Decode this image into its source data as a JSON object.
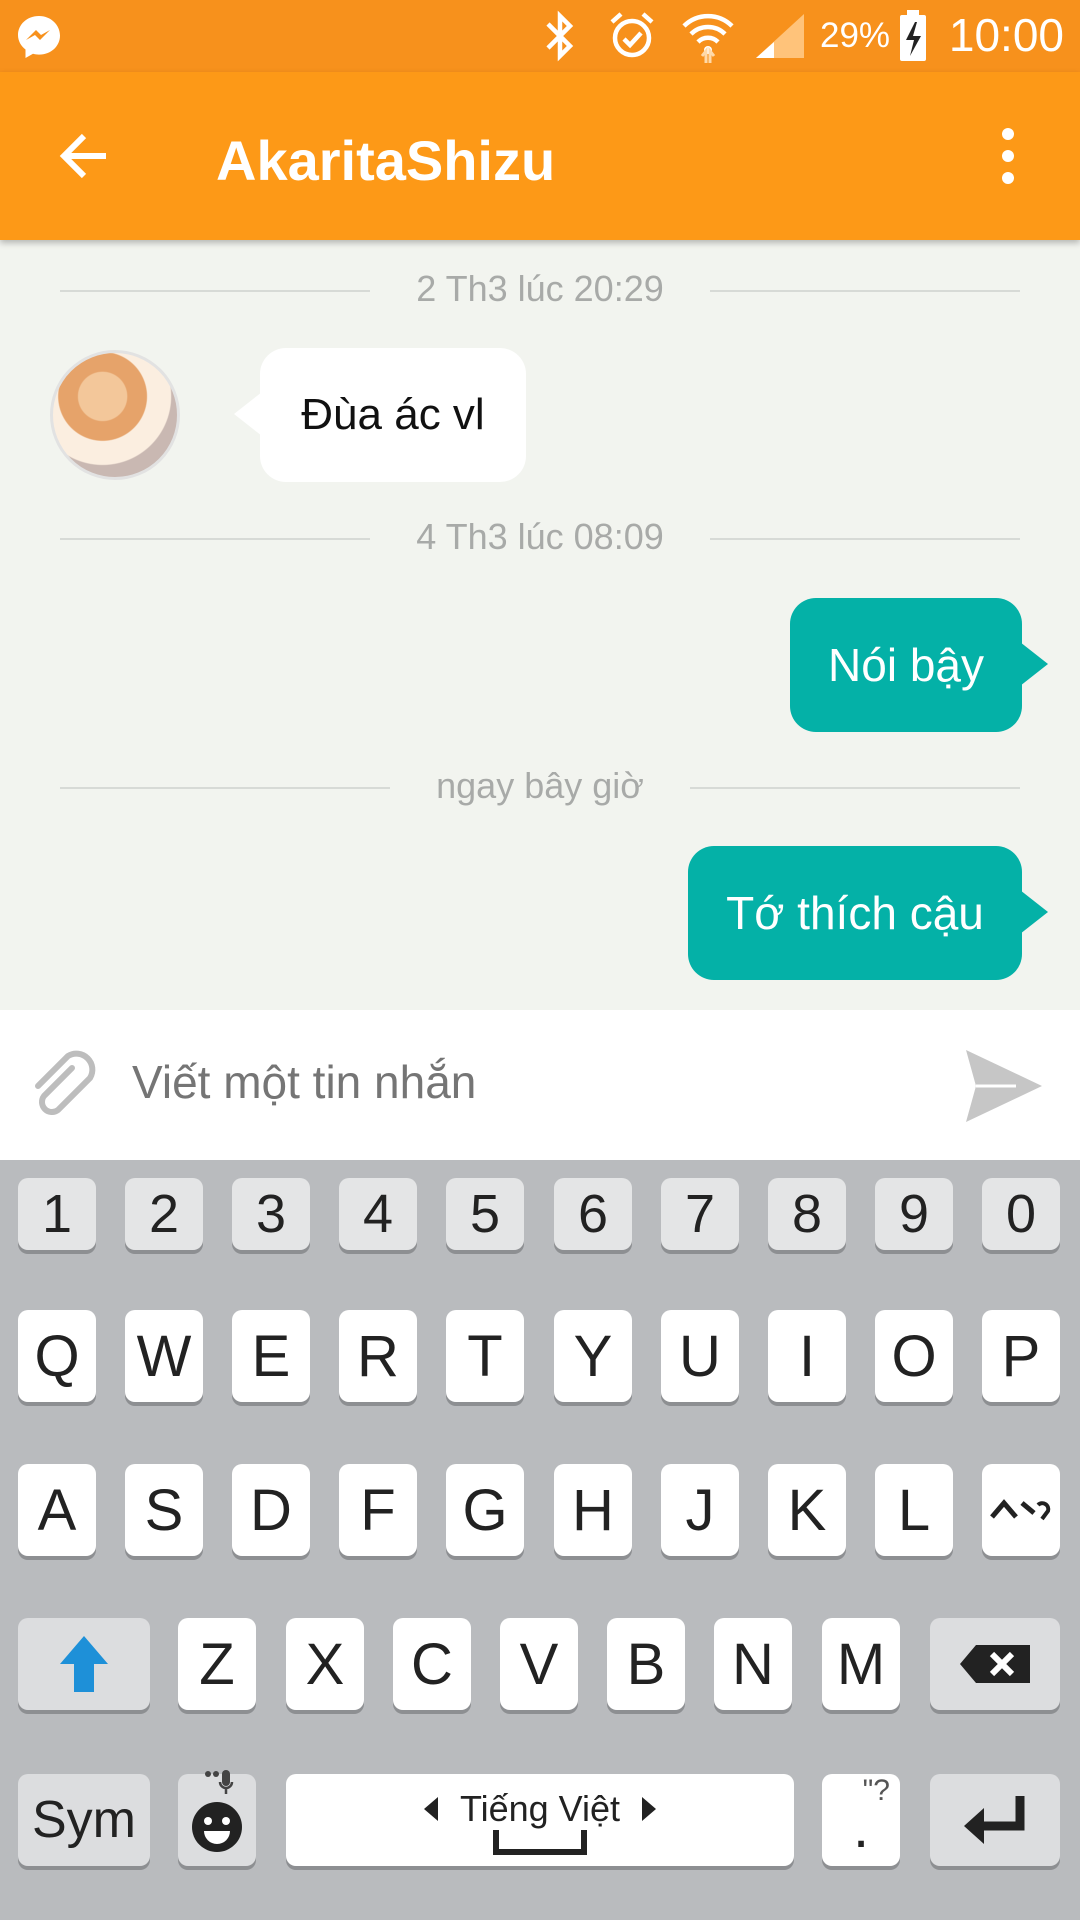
{
  "status_bar": {
    "battery": "29%",
    "time": "10:00"
  },
  "app_bar": {
    "title": "AkaritaShizu"
  },
  "messages": [
    {
      "type": "divider",
      "text": "2 Th3 lúc 20:29"
    },
    {
      "type": "incoming",
      "text": "Đùa ác vl"
    },
    {
      "type": "divider",
      "text": "4 Th3 lúc 08:09"
    },
    {
      "type": "outgoing",
      "text": "Nói bậy"
    },
    {
      "type": "divider",
      "text": "ngay bây giờ"
    },
    {
      "type": "outgoing",
      "text": "Tớ thích cậu"
    }
  ],
  "composer": {
    "placeholder": "Viết một tin nhắn"
  },
  "keyboard": {
    "numbers": [
      "1",
      "2",
      "3",
      "4",
      "5",
      "6",
      "7",
      "8",
      "9",
      "0"
    ],
    "row1": [
      "Q",
      "W",
      "E",
      "R",
      "T",
      "Y",
      "U",
      "I",
      "O",
      "P"
    ],
    "row2": [
      "A",
      "S",
      "D",
      "F",
      "G",
      "H",
      "J",
      "K",
      "L"
    ],
    "row3": [
      "Z",
      "X",
      "C",
      "V",
      "B",
      "N",
      "M"
    ],
    "sym_label": "Sym",
    "space_label": "Tiếng Việt",
    "period": ".",
    "period_hint": "\"?"
  },
  "colors": {
    "accent": "#fd9917",
    "bubble_out": "#04b1a7",
    "keyboard_bg": "#b9bbbe"
  },
  "icons": {
    "status": [
      "messenger-icon",
      "bluetooth-icon",
      "alarm-icon",
      "wifi-icon",
      "signal-icon",
      "battery-icon"
    ],
    "app_bar": [
      "back-arrow-icon",
      "more-vert-icon"
    ],
    "composer": [
      "attach-icon",
      "send-icon"
    ],
    "keyboard": [
      "shift-icon",
      "backspace-icon",
      "emoji-icon",
      "mic-icon",
      "enter-icon",
      "dakuten-icon"
    ]
  }
}
